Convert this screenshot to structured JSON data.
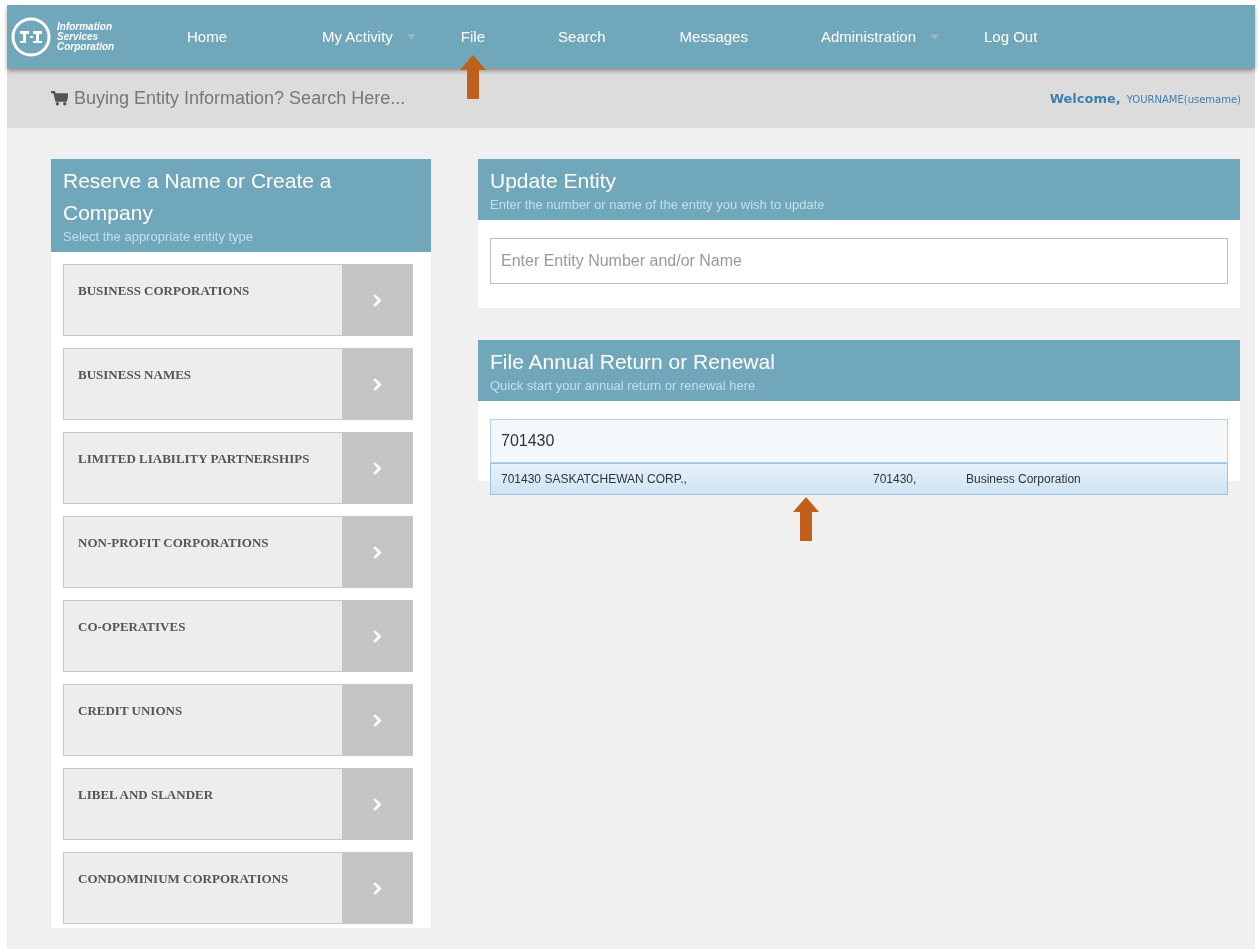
{
  "logo": {
    "lines": [
      "Information",
      "Services",
      "Corporation"
    ]
  },
  "nav": [
    {
      "label": "Home",
      "has_menu": false
    },
    {
      "label": "My Activity",
      "has_menu": true
    },
    {
      "label": "File",
      "has_menu": false
    },
    {
      "label": "Search",
      "has_menu": false
    },
    {
      "label": "Messages",
      "has_menu": false
    },
    {
      "label": "Administration",
      "has_menu": true
    },
    {
      "label": "Log Out",
      "has_menu": false
    }
  ],
  "subbar": {
    "search_link": "Buying Entity Information? Search Here...",
    "welcome": "Welcome,",
    "user": "YOURNAME(usemame)"
  },
  "reserve_panel": {
    "title": "Reserve a Name or Create a Company",
    "subtitle": "Select the appropriate entity type",
    "items": [
      "BUSINESS CORPORATIONS",
      "BUSINESS NAMES",
      "LIMITED LIABILITY PARTNERSHIPS",
      "NON-PROFIT CORPORATIONS",
      "CO-OPERATIVES",
      "CREDIT UNIONS",
      "LIBEL AND SLANDER",
      "CONDOMINIUM CORPORATIONS"
    ]
  },
  "update_panel": {
    "title": "Update Entity",
    "subtitle": "Enter the number or name of the entity you wish to update",
    "placeholder": "Enter Entity Number and/or Name"
  },
  "annual_panel": {
    "title": "File Annual Return or Renewal",
    "subtitle": "Quick start your annual return or renewal here",
    "value": "701430",
    "suggestions": [
      {
        "name": "701430 SASKATCHEWAN CORP.,",
        "number": "701430,",
        "type": "Business Corporation",
        "selected": true
      }
    ]
  }
}
